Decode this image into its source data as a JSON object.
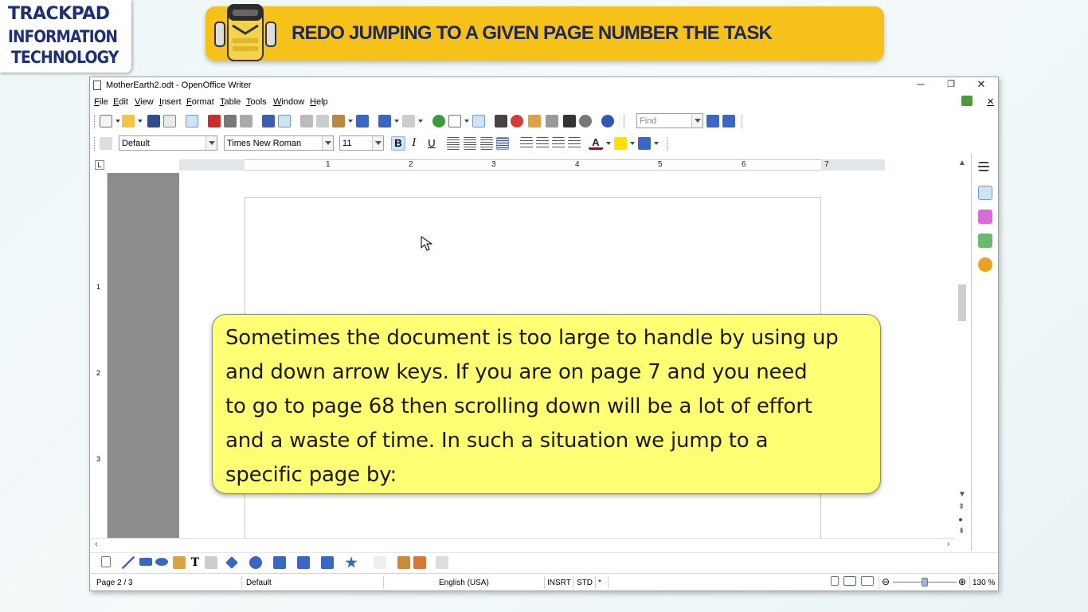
{
  "brand": {
    "line1": "TRACKPAD",
    "line2": "INFORMATION",
    "line3": "TECHNOLOGY"
  },
  "banner": {
    "title": "REDO JUMPING TO A GIVEN PAGE NUMBER THE TASK"
  },
  "window": {
    "title": "MotherEarth2.odt - OpenOffice Writer",
    "controls": {
      "minimize": "─",
      "restore": "❐",
      "close": "✕"
    },
    "doc_close": "✕"
  },
  "menu": [
    "File",
    "Edit",
    "View",
    "Insert",
    "Format",
    "Table",
    "Tools",
    "Window",
    "Help"
  ],
  "toolbar": {
    "find_placeholder": "Find"
  },
  "formatting": {
    "style": "Default",
    "font": "Times New Roman",
    "size": "11",
    "bold": "B",
    "italic": "I",
    "underline": "U",
    "font_color_glyph": "A"
  },
  "ruler": {
    "corner": "L",
    "numbers": [
      "1",
      "2",
      "3",
      "4",
      "5",
      "6",
      "7"
    ],
    "vnumbers": [
      "1",
      "2",
      "3"
    ]
  },
  "status": {
    "page": "Page 2 / 3",
    "page_style": "Default",
    "language": "English (USA)",
    "insert_mode": "INSRT",
    "selection_mode": "STD",
    "modified": "*",
    "zoom": "130 %",
    "zoom_minus": "⊖",
    "zoom_plus": "⊕"
  },
  "callout": {
    "text": "Sometimes the document is too large to handle by using up\nand down arrow keys. If you are on page 7 and you need\nto go to page 68 then scrolling down will be a lot of effort\nand a waste of time. In such a situation we jump to a\nspecific page by:"
  },
  "colors": {
    "banner": "#f6c21a",
    "brand_text": "#1e2f73",
    "callout_bg": "#ffff73",
    "doc_bg": "#8c8c8c"
  }
}
